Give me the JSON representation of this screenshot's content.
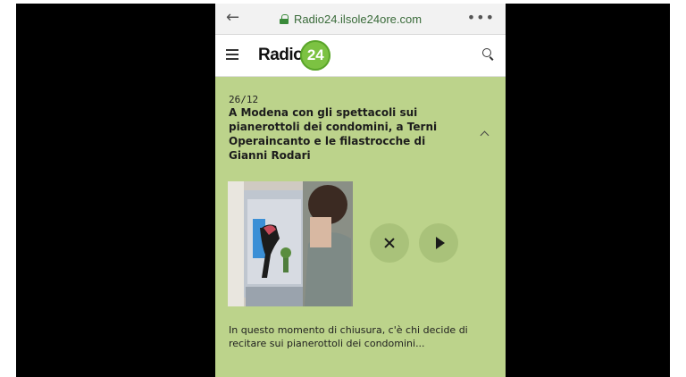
{
  "browser": {
    "back_icon": "arrow-left-icon",
    "url": "Radio24.ilsole24ore.com",
    "more_icon": "more-horizontal-icon"
  },
  "site": {
    "logo_text": "Radio",
    "logo_badge": "24",
    "brand_color": "#7cc242",
    "menu_icon": "hamburger-icon",
    "search_icon": "search-icon"
  },
  "article": {
    "date": "26/12",
    "headline": "A Modena con gli spettacoli sui pianerottoli dei condomini, a Terni Operaincanto e le filastrocche di Gianni Rodari",
    "collapse_icon": "chevron-up-icon",
    "summary": "In questo momento di chiusura, c'è chi decide di recitare sui pianerottoli dei condomini...",
    "background_color": "#bcd38b"
  },
  "player": {
    "close_icon": "close-icon",
    "play_icon": "play-icon"
  }
}
